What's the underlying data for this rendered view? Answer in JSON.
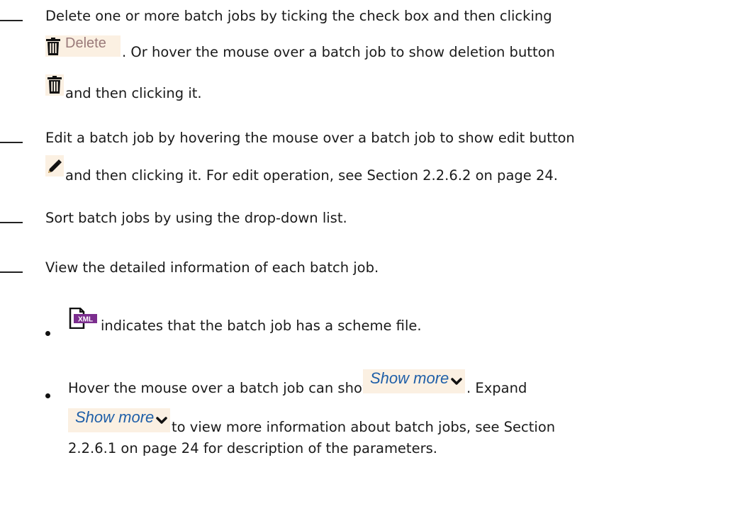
{
  "items": [
    {
      "line1": "Delete one or more batch jobs by ticking the check box and then clicking",
      "delete_button_label": "Delete",
      "line2": ". Or hover the mouse over a batch job to show deletion button",
      "line3": "and then clicking it.",
      "icons": [
        "trash-icon",
        "trash-icon"
      ]
    },
    {
      "line1": "Edit a batch job by hovering the mouse over a batch job to show edit button",
      "line2": "and then clicking it. For edit operation, see Section 2.2.6.2 on page 24.",
      "icons": [
        "pencil-icon"
      ]
    },
    {
      "line1": "Sort batch jobs by using the drop-down list."
    },
    {
      "line1": "View the detailed information of each batch job.",
      "bullets": [
        {
          "text": "indicates that the batch job has a scheme file.",
          "icon": "xml-file-icon",
          "icon_text": "XML"
        },
        {
          "line1_a": "Hover the mouse over a batch job can show",
          "show_more_label": "Show more",
          "line1_b": ". Expand",
          "line2": "to view more information about batch jobs, see Section",
          "line3": "2.2.6.1 on page 24 for description of the parameters.",
          "icons": [
            "chevron-down-icon"
          ]
        }
      ]
    }
  ],
  "colors": {
    "text": "#1a1a1a",
    "chip_background": "#fbf0e2",
    "delete_label": "#9a7a7a",
    "show_more_label": "#1f5fa8",
    "xml_badge": "#7b2d8e"
  }
}
